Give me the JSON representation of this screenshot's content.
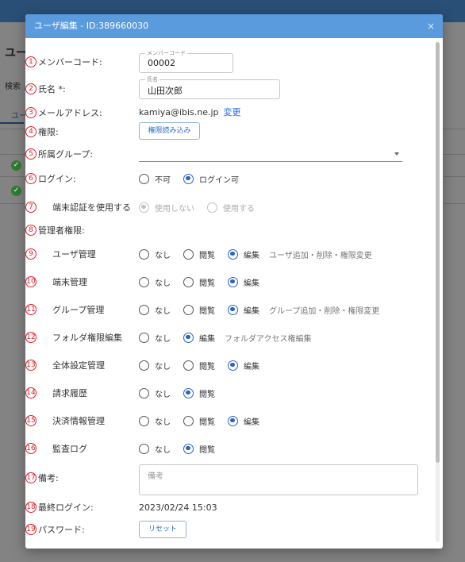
{
  "background": {
    "title": "ユー",
    "search_label": "検索",
    "tab_label": "ユー"
  },
  "dialog": {
    "title": "ユーザ編集 - ID:389660030",
    "close": "×",
    "member_code": {
      "num": "1",
      "label": "メンバーコード:",
      "legend": "メンバーコード",
      "value": "00002"
    },
    "name": {
      "num": "2",
      "label": "氏名 *:",
      "legend": "氏名",
      "value": "山田次郎"
    },
    "email": {
      "num": "3",
      "label": "メールアドレス:",
      "value": "kamiya@ibis.ne.jp",
      "change_link": "変更"
    },
    "permission": {
      "num": "4",
      "label": "権限:",
      "button": "権限読み込み"
    },
    "group": {
      "num": "5",
      "label": "所属グループ:"
    },
    "login": {
      "num": "6",
      "label": "ログイン:",
      "options": [
        "不可",
        "ログイン可"
      ],
      "selected": "ログイン可"
    },
    "device_auth": {
      "num": "7",
      "label": "端末認証を使用する",
      "options": [
        "使用しない",
        "使用する"
      ],
      "selected": "使用しない"
    },
    "admin": {
      "num": "8",
      "label": "管理者権限:"
    },
    "user_mgmt": {
      "num": "9",
      "label": "ユーザ管理",
      "options": [
        "なし",
        "閲覧",
        "編集"
      ],
      "selected": "編集",
      "note": "ユーザ追加・削除・権限変更"
    },
    "device_mgmt": {
      "num": "10",
      "label": "端末管理",
      "options": [
        "なし",
        "閲覧",
        "編集"
      ],
      "selected": "編集"
    },
    "group_mgmt": {
      "num": "11",
      "label": "グループ管理",
      "options": [
        "なし",
        "閲覧",
        "編集"
      ],
      "selected": "編集",
      "note": "グループ追加・削除・権限変更"
    },
    "folder_perm": {
      "num": "12",
      "label": "フォルダ権限編集",
      "options": [
        "なし",
        "編集"
      ],
      "selected": "編集",
      "note": "フォルダアクセス権編集"
    },
    "global_settings": {
      "num": "13",
      "label": "全体設定管理",
      "options": [
        "なし",
        "閲覧",
        "編集"
      ],
      "selected": "編集"
    },
    "billing": {
      "num": "14",
      "label": "請求履歴",
      "options": [
        "なし",
        "閲覧"
      ],
      "selected": "閲覧"
    },
    "payment": {
      "num": "15",
      "label": "決済情報管理",
      "options": [
        "なし",
        "閲覧",
        "編集"
      ],
      "selected": "編集"
    },
    "audit_log": {
      "num": "16",
      "label": "監査ログ",
      "options": [
        "なし",
        "閲覧"
      ],
      "selected": "閲覧"
    },
    "remarks": {
      "num": "17",
      "label": "備考:",
      "placeholder": "備考"
    },
    "last_login": {
      "num": "18",
      "label": "最終ログイン:",
      "value": "2023/02/24 15:03"
    },
    "password": {
      "num": "19",
      "label": "パスワード:",
      "button": "リセット"
    }
  },
  "colors": {
    "header": "#5a9bde",
    "accent": "#2a62c9",
    "marker": "#e0202c"
  }
}
